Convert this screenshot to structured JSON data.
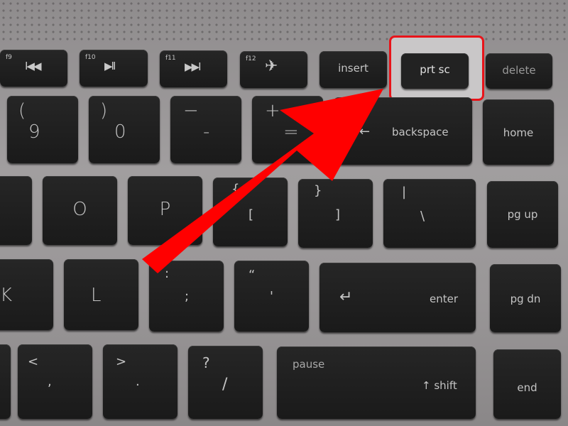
{
  "function_row": [
    {
      "fn": "f9",
      "icon": "previous-track-icon",
      "glyph": "I◀◀"
    },
    {
      "fn": "f10",
      "icon": "play-pause-icon",
      "glyph": "▶II"
    },
    {
      "fn": "f11",
      "icon": "next-track-icon",
      "glyph": "▶▶I"
    },
    {
      "fn": "f12",
      "icon": "airplane-mode-icon",
      "glyph": "✈"
    }
  ],
  "keys": {
    "insert": "insert",
    "prtsc": "prt sc",
    "delete": "delete",
    "nine_top": "(",
    "nine": "9",
    "zero_top": ")",
    "zero": "0",
    "minus_top": "−",
    "minus": "-",
    "equals_top": "+",
    "equals": "=",
    "backspace_arrow": "←",
    "backspace": "backspace",
    "home": "home",
    "o": "O",
    "p": "P",
    "lbracket_top": "{",
    "lbracket": "[",
    "rbracket_top": "}",
    "rbracket": "]",
    "backslash_top": "|",
    "backslash": "\\",
    "pgup": "pg up",
    "k": "K",
    "l": "L",
    "semicolon_top": ":",
    "semicolon": ";",
    "quote_top": "“",
    "quote": "'",
    "enter_arrow": "↵",
    "enter": "enter",
    "pgdn": "pg dn",
    "comma_top": "<",
    "comma": ",",
    "period_top": ">",
    "period": ".",
    "slash_top": "?",
    "slash": "/",
    "pause": "pause",
    "shift": "↑ shift",
    "end": "end"
  },
  "colors": {
    "highlight": "#e8141a",
    "arrow": "#ff0000"
  }
}
